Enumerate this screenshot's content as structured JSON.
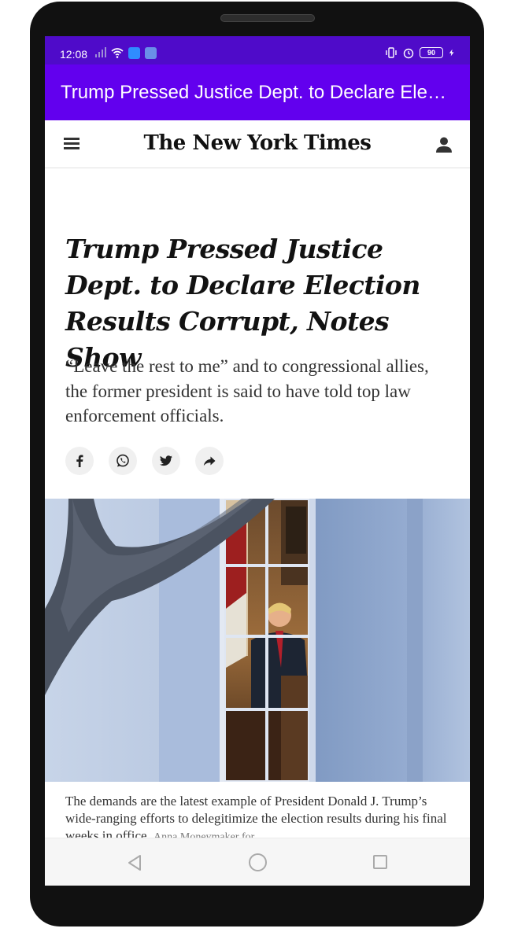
{
  "status_bar": {
    "time": "12:08",
    "battery": "90"
  },
  "app_bar": {
    "title": "Trump Pressed Justice Dept. to Declare Election Results Corrupt, Notes Show"
  },
  "header": {
    "logo": "The New York Times",
    "menu_icon": "hamburger-menu-icon",
    "account_icon": "account-icon"
  },
  "article": {
    "headline": "Trump Pressed Justice Dept. to Declare Election Results Corrupt, Notes Show",
    "summary": "“Leave the rest to me” and to congressional allies, the former president is said to have told top law enforcement officials.",
    "share_icons": [
      "facebook-icon",
      "whatsapp-icon",
      "twitter-icon",
      "share-icon"
    ],
    "caption": "The demands are the latest example of President Donald J. Trump’s wide-ranging efforts to delegitimize the election results during his final weeks in office.",
    "credit": "Anna Moneymaker for"
  },
  "colors": {
    "status_bar": "#4f0bc9",
    "app_bar": "#6200ee"
  }
}
